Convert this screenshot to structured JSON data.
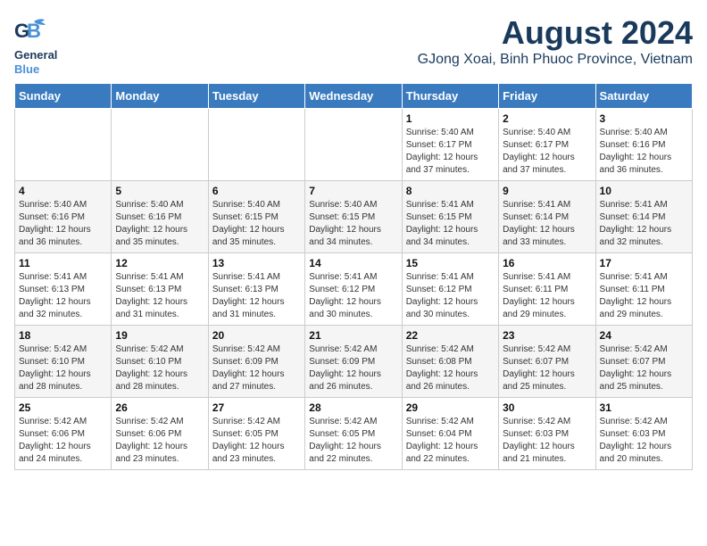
{
  "logo": {
    "line1": "General",
    "line2": "Blue"
  },
  "title": "August 2024",
  "subtitle": "GJong Xoai, Binh Phuoc Province, Vietnam",
  "days_of_week": [
    "Sunday",
    "Monday",
    "Tuesday",
    "Wednesday",
    "Thursday",
    "Friday",
    "Saturday"
  ],
  "weeks": [
    [
      {
        "day": "",
        "info": ""
      },
      {
        "day": "",
        "info": ""
      },
      {
        "day": "",
        "info": ""
      },
      {
        "day": "",
        "info": ""
      },
      {
        "day": "1",
        "info": "Sunrise: 5:40 AM\nSunset: 6:17 PM\nDaylight: 12 hours\nand 37 minutes."
      },
      {
        "day": "2",
        "info": "Sunrise: 5:40 AM\nSunset: 6:17 PM\nDaylight: 12 hours\nand 37 minutes."
      },
      {
        "day": "3",
        "info": "Sunrise: 5:40 AM\nSunset: 6:16 PM\nDaylight: 12 hours\nand 36 minutes."
      }
    ],
    [
      {
        "day": "4",
        "info": "Sunrise: 5:40 AM\nSunset: 6:16 PM\nDaylight: 12 hours\nand 36 minutes."
      },
      {
        "day": "5",
        "info": "Sunrise: 5:40 AM\nSunset: 6:16 PM\nDaylight: 12 hours\nand 35 minutes."
      },
      {
        "day": "6",
        "info": "Sunrise: 5:40 AM\nSunset: 6:15 PM\nDaylight: 12 hours\nand 35 minutes."
      },
      {
        "day": "7",
        "info": "Sunrise: 5:40 AM\nSunset: 6:15 PM\nDaylight: 12 hours\nand 34 minutes."
      },
      {
        "day": "8",
        "info": "Sunrise: 5:41 AM\nSunset: 6:15 PM\nDaylight: 12 hours\nand 34 minutes."
      },
      {
        "day": "9",
        "info": "Sunrise: 5:41 AM\nSunset: 6:14 PM\nDaylight: 12 hours\nand 33 minutes."
      },
      {
        "day": "10",
        "info": "Sunrise: 5:41 AM\nSunset: 6:14 PM\nDaylight: 12 hours\nand 32 minutes."
      }
    ],
    [
      {
        "day": "11",
        "info": "Sunrise: 5:41 AM\nSunset: 6:13 PM\nDaylight: 12 hours\nand 32 minutes."
      },
      {
        "day": "12",
        "info": "Sunrise: 5:41 AM\nSunset: 6:13 PM\nDaylight: 12 hours\nand 31 minutes."
      },
      {
        "day": "13",
        "info": "Sunrise: 5:41 AM\nSunset: 6:13 PM\nDaylight: 12 hours\nand 31 minutes."
      },
      {
        "day": "14",
        "info": "Sunrise: 5:41 AM\nSunset: 6:12 PM\nDaylight: 12 hours\nand 30 minutes."
      },
      {
        "day": "15",
        "info": "Sunrise: 5:41 AM\nSunset: 6:12 PM\nDaylight: 12 hours\nand 30 minutes."
      },
      {
        "day": "16",
        "info": "Sunrise: 5:41 AM\nSunset: 6:11 PM\nDaylight: 12 hours\nand 29 minutes."
      },
      {
        "day": "17",
        "info": "Sunrise: 5:41 AM\nSunset: 6:11 PM\nDaylight: 12 hours\nand 29 minutes."
      }
    ],
    [
      {
        "day": "18",
        "info": "Sunrise: 5:42 AM\nSunset: 6:10 PM\nDaylight: 12 hours\nand 28 minutes."
      },
      {
        "day": "19",
        "info": "Sunrise: 5:42 AM\nSunset: 6:10 PM\nDaylight: 12 hours\nand 28 minutes."
      },
      {
        "day": "20",
        "info": "Sunrise: 5:42 AM\nSunset: 6:09 PM\nDaylight: 12 hours\nand 27 minutes."
      },
      {
        "day": "21",
        "info": "Sunrise: 5:42 AM\nSunset: 6:09 PM\nDaylight: 12 hours\nand 26 minutes."
      },
      {
        "day": "22",
        "info": "Sunrise: 5:42 AM\nSunset: 6:08 PM\nDaylight: 12 hours\nand 26 minutes."
      },
      {
        "day": "23",
        "info": "Sunrise: 5:42 AM\nSunset: 6:07 PM\nDaylight: 12 hours\nand 25 minutes."
      },
      {
        "day": "24",
        "info": "Sunrise: 5:42 AM\nSunset: 6:07 PM\nDaylight: 12 hours\nand 25 minutes."
      }
    ],
    [
      {
        "day": "25",
        "info": "Sunrise: 5:42 AM\nSunset: 6:06 PM\nDaylight: 12 hours\nand 24 minutes."
      },
      {
        "day": "26",
        "info": "Sunrise: 5:42 AM\nSunset: 6:06 PM\nDaylight: 12 hours\nand 23 minutes."
      },
      {
        "day": "27",
        "info": "Sunrise: 5:42 AM\nSunset: 6:05 PM\nDaylight: 12 hours\nand 23 minutes."
      },
      {
        "day": "28",
        "info": "Sunrise: 5:42 AM\nSunset: 6:05 PM\nDaylight: 12 hours\nand 22 minutes."
      },
      {
        "day": "29",
        "info": "Sunrise: 5:42 AM\nSunset: 6:04 PM\nDaylight: 12 hours\nand 22 minutes."
      },
      {
        "day": "30",
        "info": "Sunrise: 5:42 AM\nSunset: 6:03 PM\nDaylight: 12 hours\nand 21 minutes."
      },
      {
        "day": "31",
        "info": "Sunrise: 5:42 AM\nSunset: 6:03 PM\nDaylight: 12 hours\nand 20 minutes."
      }
    ]
  ]
}
